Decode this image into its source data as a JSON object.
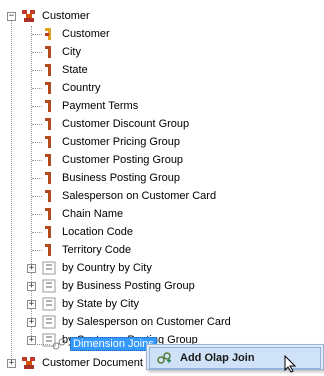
{
  "tree": {
    "root_label": "Customer",
    "children": [
      {
        "label": "Customer",
        "kind": "key"
      },
      {
        "label": "City",
        "kind": "attr"
      },
      {
        "label": "State",
        "kind": "attr"
      },
      {
        "label": "Country",
        "kind": "attr"
      },
      {
        "label": "Payment Terms",
        "kind": "attr"
      },
      {
        "label": "Customer Discount Group",
        "kind": "attr"
      },
      {
        "label": "Customer Pricing Group",
        "kind": "attr"
      },
      {
        "label": "Customer Posting Group",
        "kind": "attr"
      },
      {
        "label": "Business Posting Group",
        "kind": "attr"
      },
      {
        "label": "Salesperson on Customer Card",
        "kind": "attr"
      },
      {
        "label": "Chain Name",
        "kind": "attr"
      },
      {
        "label": "Location Code",
        "kind": "attr"
      },
      {
        "label": "Territory Code",
        "kind": "attr"
      }
    ],
    "hierarchies": [
      {
        "label": "by Country by City"
      },
      {
        "label": "by Business Posting Group"
      },
      {
        "label": "by State by City"
      },
      {
        "label": "by Salesperson on Customer Card"
      },
      {
        "label": "by Customer Posting Group"
      }
    ],
    "joins_label": "Dimension Joins",
    "next_root_label": "Customer Document"
  },
  "context_menu": {
    "item_label": "Add Olap Join"
  },
  "colors": {
    "selection": "#3399ff",
    "attr_icon": "#b34a1a",
    "key_icon": "#e0a020",
    "menu_bg": "#dfeaf6"
  }
}
